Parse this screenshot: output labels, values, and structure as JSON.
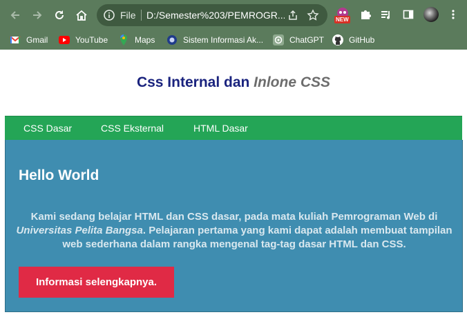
{
  "browser": {
    "omnibox": {
      "scheme_label": "File",
      "url": "D:/Semester%203/PEMROGR..."
    },
    "extension_badge": "NEW",
    "bookmarks": [
      {
        "label": "Gmail",
        "icon": "gmail-icon"
      },
      {
        "label": "YouTube",
        "icon": "youtube-icon"
      },
      {
        "label": "Maps",
        "icon": "maps-icon"
      },
      {
        "label": "Sistem Informasi Ak...",
        "icon": "university-icon"
      },
      {
        "label": "ChatGPT",
        "icon": "chatgpt-icon"
      },
      {
        "label": "GitHub",
        "icon": "github-icon"
      }
    ]
  },
  "page": {
    "title_main": "Css Internal dan ",
    "title_italic": "Inlone CSS",
    "menu": [
      {
        "label": "CSS Dasar"
      },
      {
        "label": "CSS Eksternal"
      },
      {
        "label": "HTML Dasar"
      }
    ],
    "heading": "Hello World",
    "description_before": "Kami sedang belajar HTML dan CSS dasar, pada mata kuliah Pemrograman Web di ",
    "description_italic": "Universitas Pelita Bangsa",
    "description_after": ". Pelajaran pertama yang kami dapat adalah membuat tampilan web sederhana dalam rangka mengenal tag-tag dasar HTML dan CSS.",
    "button_label": "Informasi selengkapnya."
  },
  "colors": {
    "chrome": "#5b7b5c",
    "title": "#1a237e",
    "menu_bg": "#24a556",
    "panel_bg": "#3f8db0",
    "button_bg": "#e02a45"
  }
}
